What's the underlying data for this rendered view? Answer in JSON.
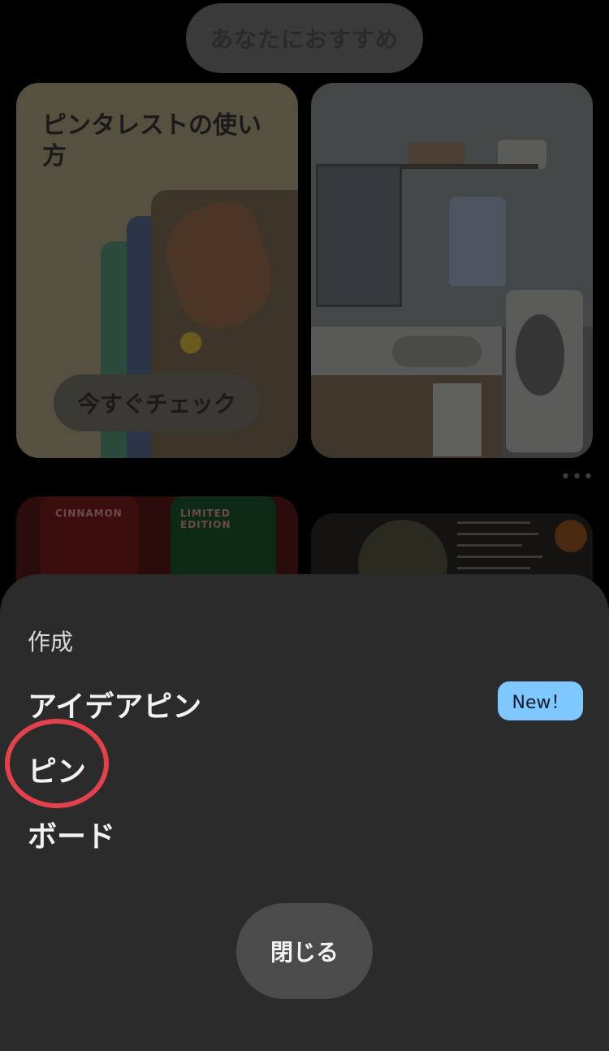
{
  "feed": {
    "tab_label": "あなたにおすすめ",
    "guide_card": {
      "title": "ピンタレストの使い方",
      "cta_label": "今すぐチェック"
    },
    "cola_card": {
      "left_label": "CINNAMON",
      "right_label": "LIMITED EDITION"
    },
    "more_icon": "more-horizontal-icon"
  },
  "sheet": {
    "heading": "作成",
    "options": [
      {
        "label": "アイデアピン",
        "badge": "New！"
      },
      {
        "label": "ピン"
      },
      {
        "label": "ボード"
      }
    ],
    "close_label": "閉じる"
  },
  "colors": {
    "sheet_bg": "#2b2b2b",
    "badge_bg": "#7fc8ff",
    "annotation": "#e3414b",
    "close_bg": "#4b4b4b"
  }
}
